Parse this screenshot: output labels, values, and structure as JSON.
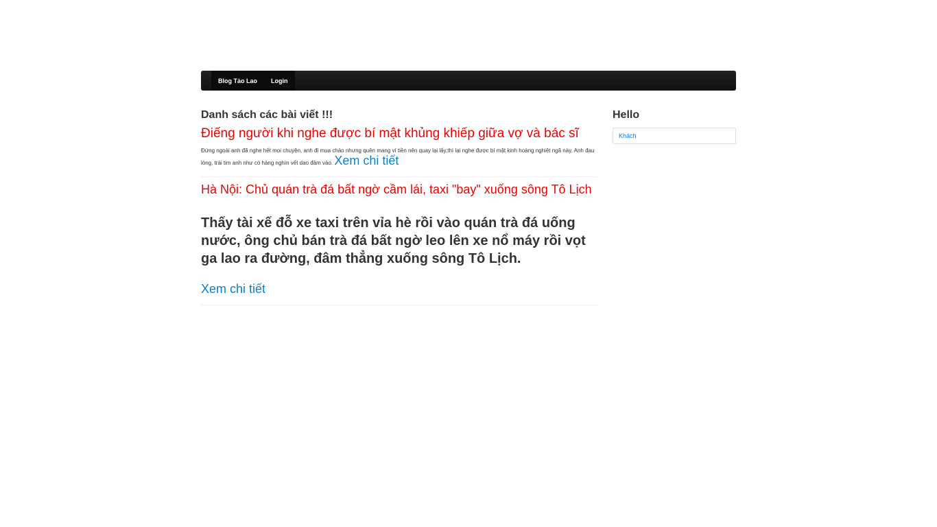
{
  "nav": {
    "items": [
      {
        "label": "Blog Tảo Lao"
      },
      {
        "label": "Login"
      }
    ]
  },
  "main": {
    "section_title": "Danh sách các bài viết !!!",
    "posts": [
      {
        "title": "Điếng người khi nghe được bí mật khủng khiếp giữa vợ và bác sĩ",
        "summary": "Đứng ngoài anh đã nghe hết mọi chuyện, anh đi mua cháo nhưng quên mang ví tiền nên quay lại lấy,thì lại nghe được bí mật kinh hoàng nghiệt ngã này. Anh đau lòng, trái tim anh như có hàng nghìn vết dao đâm vào.",
        "more_label": "Xem chi tiết"
      },
      {
        "title": "Hà Nội: Chủ quán trà đá bất ngờ cầm lái, taxi \"bay\" xuống sông Tô Lịch",
        "summary": "Thấy tài xế đỗ xe taxi trên vỉa hè rồi vào quán trà đá uống nước, ông chủ bán trà đá bất ngờ leo lên xe nổ máy rồi vọt ga lao ra đường, đâm thẳng xuống sông Tô Lịch.",
        "more_label": "Xem chi tiết"
      }
    ]
  },
  "sidebar": {
    "title": "Hello",
    "guest_label": "Khách"
  },
  "colors": {
    "navbar": "#1b1b1b",
    "post_title": "#ee0000",
    "link": "#0b7fcc"
  }
}
